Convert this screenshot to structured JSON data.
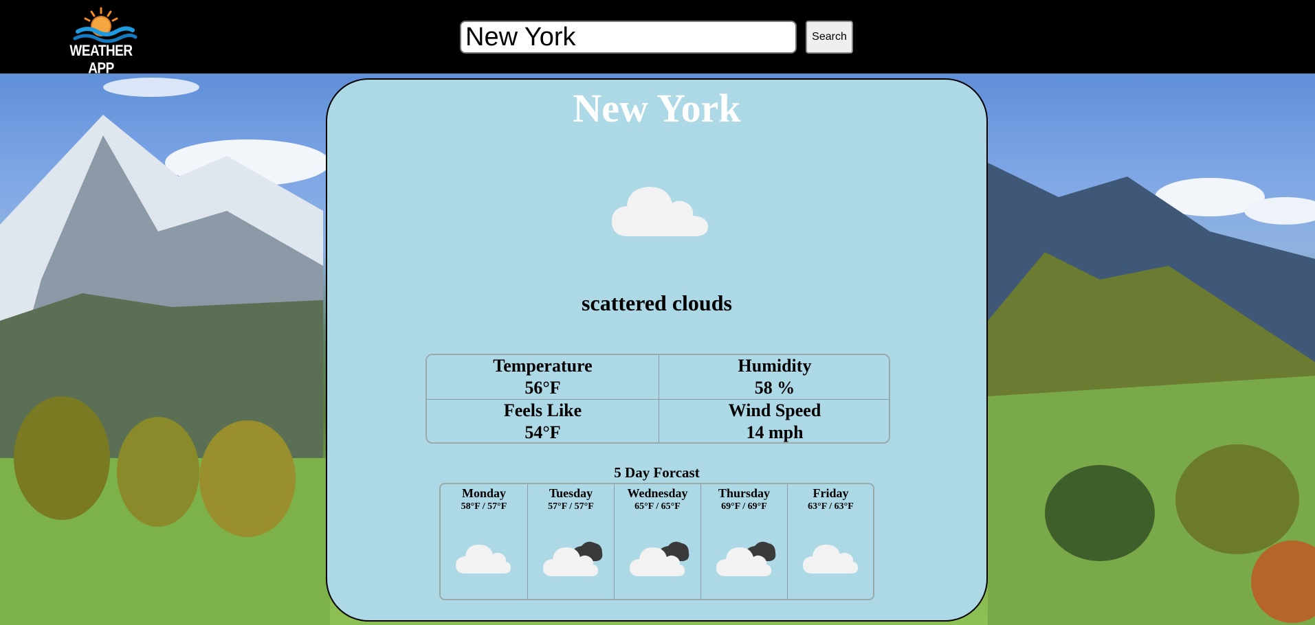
{
  "header": {
    "logo_text": "WEATHER APP",
    "search_value": "New York",
    "search_button": "Search"
  },
  "current": {
    "city": "New York",
    "description": "scattered clouds",
    "icon": "cloud-icon"
  },
  "stats": {
    "temperature_label": "Temperature",
    "temperature_value": "56°F",
    "humidity_label": "Humidity",
    "humidity_value": "58 %",
    "feels_like_label": "Feels Like",
    "feels_like_value": "54°F",
    "wind_label": "Wind Speed",
    "wind_value": "14 mph"
  },
  "forecast": {
    "title": "5 Day Forcast",
    "days": [
      {
        "day": "Monday",
        "temps": "58°F / 57°F",
        "icon": "cloud-icon"
      },
      {
        "day": "Tuesday",
        "temps": "57°F / 57°F",
        "icon": "broken-clouds-icon"
      },
      {
        "day": "Wednesday",
        "temps": "65°F / 65°F",
        "icon": "broken-clouds-icon"
      },
      {
        "day": "Thursday",
        "temps": "69°F / 69°F",
        "icon": "broken-clouds-icon"
      },
      {
        "day": "Friday",
        "temps": "63°F / 63°F",
        "icon": "cloud-icon"
      }
    ]
  },
  "colors": {
    "card_bg": "#add8e6",
    "header_bg": "#000000",
    "city_text": "#ffffff"
  }
}
